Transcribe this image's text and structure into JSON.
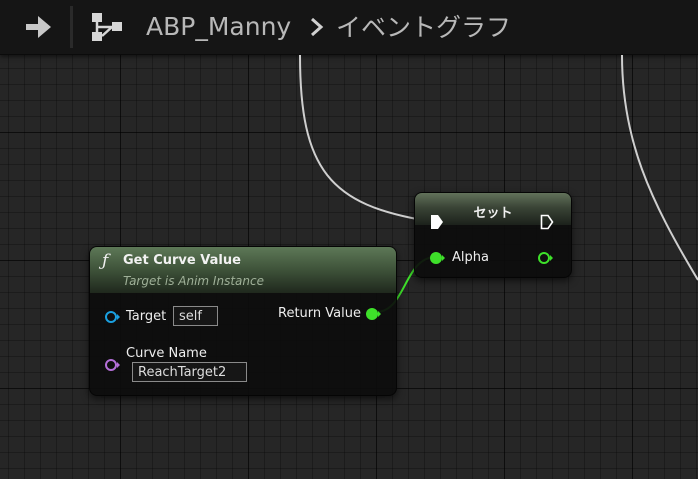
{
  "breadcrumb": {
    "asset_name": "ABP_Manny",
    "graph_name": "イベントグラフ"
  },
  "icons": {
    "back": "arrow-right-icon",
    "graph": "graph-hierarchy-icon",
    "separator": "chevron-right-icon",
    "function": "function-icon",
    "exec_pin": "exec-pin-icon",
    "float_pin": "float-pin-icon",
    "object_pin": "object-pin-icon",
    "name_pin": "name-pin-icon"
  },
  "set_node": {
    "title": "セット",
    "alpha_label": "Alpha"
  },
  "function_node": {
    "icon_glyph": "ƒ",
    "title": "Get Curve Value",
    "subtitle": "Target is Anim Instance",
    "target_label": "Target",
    "target_value": "self",
    "return_label": "Return Value",
    "curve_name_label": "Curve Name",
    "curve_name_value": "ReachTarget2"
  },
  "colors": {
    "float_pin": "#3ee02a",
    "object_pin": "#1aa0e0",
    "name_pin": "#b46fd8",
    "exec_wire": "#cfcfcf",
    "node_header": "#4f6a49"
  }
}
